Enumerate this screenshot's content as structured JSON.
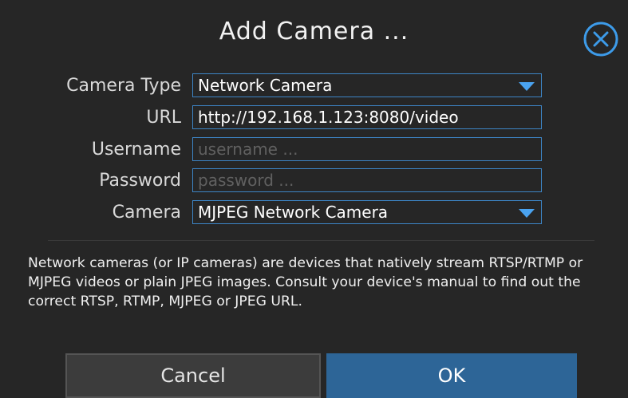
{
  "dialog": {
    "title": "Add Camera ...",
    "close_icon": "close-circle-icon"
  },
  "form": {
    "camera_type": {
      "label": "Camera Type",
      "value": "Network Camera"
    },
    "url": {
      "label": "URL",
      "value": "http://192.168.1.123:8080/video"
    },
    "username": {
      "label": "Username",
      "value": "",
      "placeholder": "username ..."
    },
    "password": {
      "label": "Password",
      "value": "",
      "placeholder": "password ..."
    },
    "camera": {
      "label": "Camera",
      "value": "MJPEG Network Camera"
    }
  },
  "description": "Network cameras (or IP cameras) are devices that natively stream RTSP/RTMP or MJPEG videos or plain JPEG images. Consult your device's manual to find out the correct RTSP, RTMP, MJPEG or JPEG URL.",
  "buttons": {
    "cancel": "Cancel",
    "ok": "OK"
  },
  "colors": {
    "background": "#262626",
    "accent": "#3d85c6",
    "ok_button": "#2d6597",
    "cancel_button": "#3c3c3c"
  }
}
